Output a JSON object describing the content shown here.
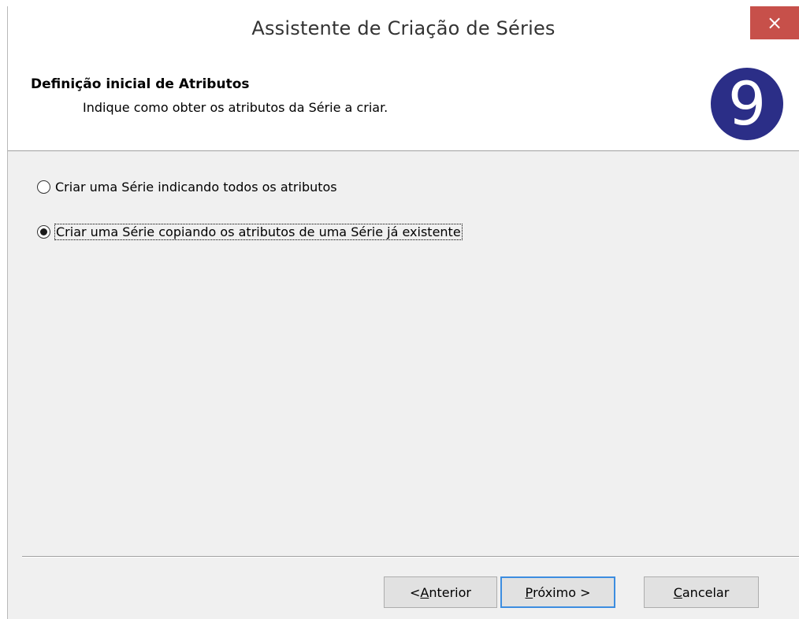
{
  "window": {
    "title": "Assistente de Criação de Séries",
    "close_glyph": "×"
  },
  "header": {
    "title": "Definição inicial de Atributos",
    "subtitle": "Indique como obter os atributos da Série a criar.",
    "logo_icon": "primavera-9-logo-icon",
    "logo_glyph": "9"
  },
  "options": {
    "selected_index": 1,
    "items": [
      {
        "label": "Criar uma Série indicando todos os atributos",
        "checked": false
      },
      {
        "label": "Criar uma Série copiando os atributos de uma Série já existente",
        "checked": true
      }
    ]
  },
  "buttons": {
    "back": {
      "prefix": "< ",
      "mnemonic": "A",
      "rest": "nterior"
    },
    "next": {
      "mnemonic": "P",
      "rest": "róximo >"
    },
    "cancel": {
      "mnemonic": "C",
      "rest": "ancelar"
    }
  },
  "colors": {
    "close_bg": "#c7504a",
    "logo_bg": "#2b2e87",
    "content_bg": "#f0f0f0",
    "default_button_border": "#3c8de0"
  }
}
